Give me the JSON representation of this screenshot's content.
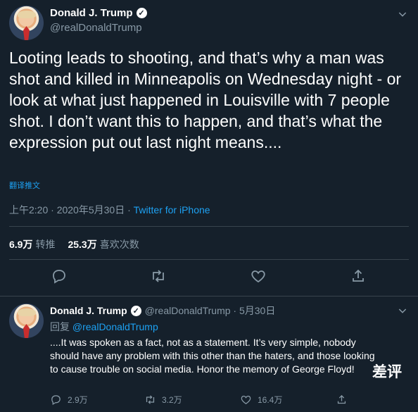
{
  "main_tweet": {
    "display_name": "Donald J. Trump",
    "handle": "@realDonaldTrump",
    "text": "Looting leads to shooting, and that’s why a man was shot and killed in Minneapolis on Wednesday night - or look at what just happened in Louisville with 7 people shot. I don’t want this to happen, and that’s what the expression put out last night means....",
    "translate_label": "翻译推文",
    "timestamp": "上午2:20 · 2020年5月30日 · ",
    "source": "Twitter for iPhone",
    "retweets": {
      "count": "6.9万",
      "label": "转推"
    },
    "likes": {
      "count": "25.3万",
      "label": "喜欢次数"
    }
  },
  "reply_tweet": {
    "display_name": "Donald J. Trump",
    "handle_date": "@realDonaldTrump · 5月30日",
    "reply_prefix": "回复 ",
    "reply_to": "@realDonaldTrump",
    "text": "....It was spoken as a fact, not as a statement. It’s very simple, nobody should have any problem with this other than the haters, and those looking to cause trouble on social media. Honor the memory of George Floyd!",
    "reply_count": "2.9万",
    "retweet_count": "3.2万",
    "like_count": "16.4万"
  },
  "watermark": "差评",
  "icons": [
    "verified-icon",
    "chevron-down-icon",
    "reply-icon",
    "retweet-icon",
    "like-icon",
    "share-icon"
  ],
  "colors": {
    "background": "#15202b",
    "accent": "#1da1f2",
    "muted": "#8899a6",
    "divider": "#38444d"
  }
}
